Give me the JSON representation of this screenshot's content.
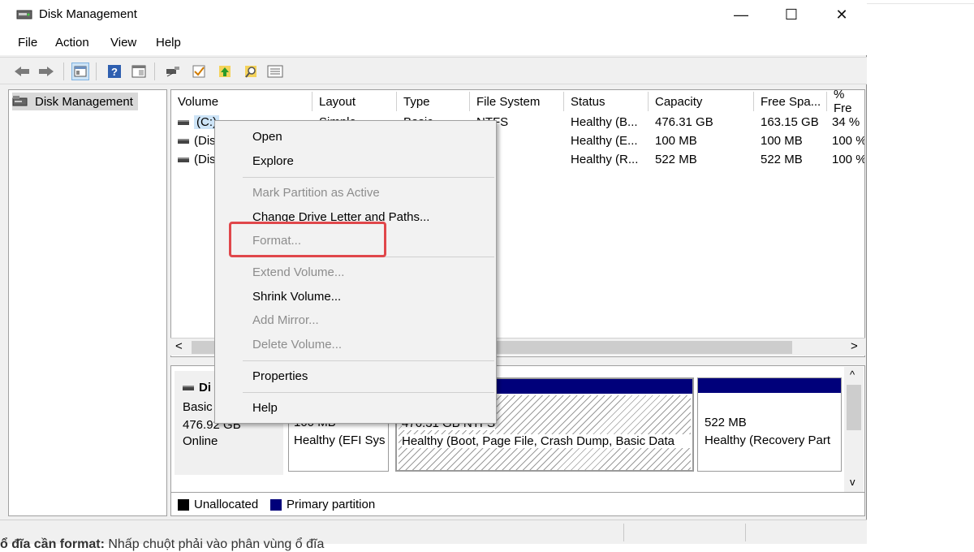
{
  "window": {
    "title": "Disk Management"
  },
  "titlebar_buttons": {
    "minimize": "—",
    "maximize": "☐",
    "close": "✕"
  },
  "menubar": {
    "items": [
      "File",
      "Action",
      "View",
      "Help"
    ]
  },
  "tree": {
    "root_label": "Disk Management"
  },
  "volume_list": {
    "columns": [
      "Volume",
      "Layout",
      "Type",
      "File System",
      "Status",
      "Capacity",
      "Free Spa...",
      "% Fre"
    ],
    "rows": [
      {
        "volume": "(C:)",
        "layout": "Simple",
        "type": "Basic",
        "file_system": "NTFS",
        "status": "Healthy (B...",
        "capacity": "476.31 GB",
        "free": "163.15 GB",
        "pct": "34 %"
      },
      {
        "volume": "(Dis",
        "layout": "",
        "type": "",
        "file_system": "",
        "status": "Healthy (E...",
        "capacity": "100 MB",
        "free": "100 MB",
        "pct": "100 %"
      },
      {
        "volume": "(Dis",
        "layout": "",
        "type": "",
        "file_system": "",
        "status": "Healthy (R...",
        "capacity": "522 MB",
        "free": "522 MB",
        "pct": "100 %"
      }
    ]
  },
  "scroll_arrows": {
    "left": "<",
    "right": ">",
    "up": "^",
    "down": "v"
  },
  "disk_panel": {
    "disk_label": "Di",
    "disk_type": "Basic",
    "disk_size": "476.92 GB",
    "disk_state": "Online",
    "partitions": [
      {
        "size": "100 MB",
        "status": "Healthy (EFI Sys"
      },
      {
        "size": "476.31 GB NTFS",
        "status": "Healthy (Boot, Page File, Crash Dump, Basic Data"
      },
      {
        "size": "522 MB",
        "status": "Healthy (Recovery Part"
      }
    ]
  },
  "legend": {
    "unallocated": "Unallocated",
    "primary": "Primary partition"
  },
  "colors": {
    "primary_partition": "#00007a",
    "unallocated": "#000000",
    "highlight_box": "#e0474b"
  },
  "context_menu": {
    "open": "Open",
    "explore": "Explore",
    "mark_active": "Mark Partition as Active",
    "change_letter": "Change Drive Letter and Paths...",
    "format": "Format...",
    "extend": "Extend Volume...",
    "shrink": "Shrink Volume...",
    "add_mirror": "Add Mirror...",
    "delete": "Delete Volume...",
    "properties": "Properties",
    "help": "Help"
  },
  "article": {
    "caption_bold": "ổ đĩa cần format:",
    "caption_rest": " Nhấp chuột phải vào phân vùng ổ đĩa"
  },
  "icons": [
    "app-disk-icon",
    "back-arrow-icon",
    "forward-arrow-icon",
    "console-tree-icon",
    "help-icon",
    "properties-icon",
    "connect-icon",
    "check-icon",
    "up-icon",
    "search-icon",
    "list-icon",
    "drive-icon"
  ]
}
